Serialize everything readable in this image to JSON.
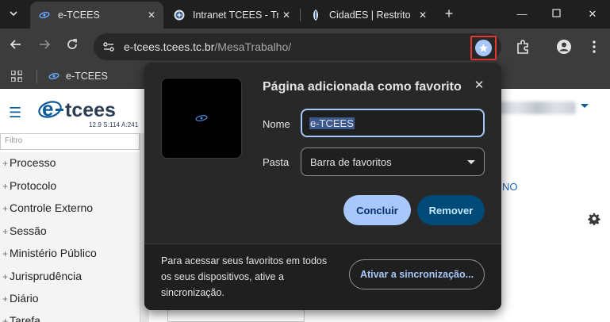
{
  "browser": {
    "tabs": [
      {
        "title": "e-TCEES",
        "active": true
      },
      {
        "title": "Intranet TCEES - Tri",
        "active": false
      },
      {
        "title": "CidadES | Restrito",
        "active": false
      }
    ],
    "omnibox": {
      "host": "e-tcees.tcees.tc.br",
      "path": "/MesaTrabalho/"
    },
    "bookmarks_bar": [
      {
        "label": "e-TCEES"
      }
    ]
  },
  "page": {
    "logo_text": "e-tcees",
    "logo_subtext": "12.9 S:114 A:241",
    "filter_placeholder": "Filtro",
    "menu": [
      "Processo",
      "Protocolo",
      "Controle Externo",
      "Sessão",
      "Ministério Público",
      "Jurisprudência",
      "Diário",
      "Tarefa"
    ],
    "partial_text": "NO"
  },
  "bookmark_bubble": {
    "title": "Página adicionada como favorito",
    "name_label": "Nome",
    "name_value": "e-TCEES",
    "folder_label": "Pasta",
    "folder_value": "Barra de favoritos",
    "done_label": "Concluir",
    "remove_label": "Remover",
    "sync_text": "Para acessar seus favoritos em todos os seus dispositivos, ative a sincronização.",
    "sync_button": "Ativar a sincronização..."
  },
  "colors": {
    "accent": "#a8c7fa",
    "remove_bg": "#004a77",
    "highlight_border": "#e53935",
    "brand_blue": "#0f5a99"
  }
}
